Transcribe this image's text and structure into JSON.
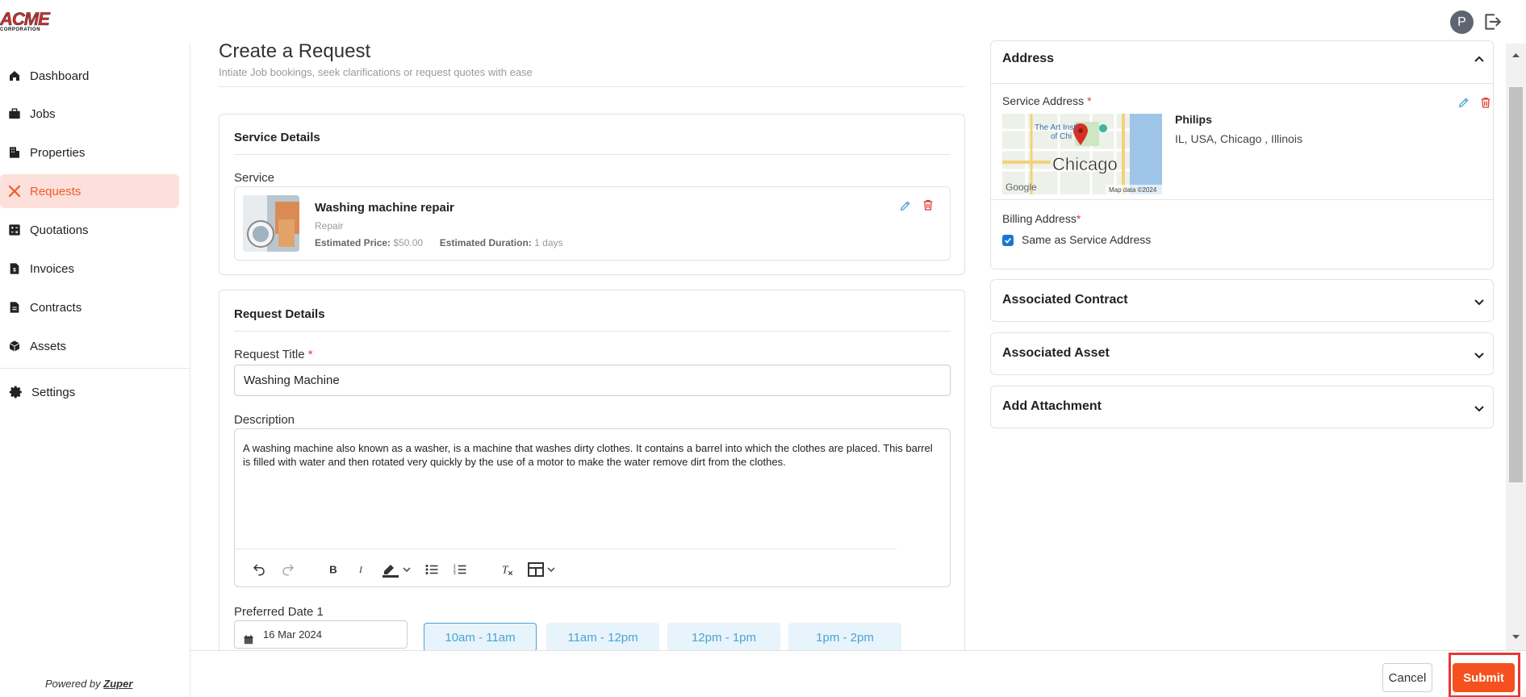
{
  "brand": {
    "logo_text": "ACME",
    "logo_sub": "CORPORATION"
  },
  "header": {
    "avatar_initial": "P"
  },
  "sidebar": {
    "items": [
      {
        "label": "Dashboard",
        "icon": "home-icon",
        "active": false
      },
      {
        "label": "Jobs",
        "icon": "briefcase-icon",
        "active": false
      },
      {
        "label": "Properties",
        "icon": "building-icon",
        "active": false
      },
      {
        "label": "Requests",
        "icon": "tools-icon",
        "active": true
      },
      {
        "label": "Quotations",
        "icon": "calculator-icon",
        "active": false
      },
      {
        "label": "Invoices",
        "icon": "invoice-icon",
        "active": false
      },
      {
        "label": "Contracts",
        "icon": "document-icon",
        "active": false
      },
      {
        "label": "Assets",
        "icon": "box-icon",
        "active": false
      },
      {
        "label": "Settings",
        "icon": "gear-icon",
        "active": false
      }
    ],
    "powered_by": "Powered by",
    "powered_brand": "Zuper"
  },
  "page": {
    "title": "Create a Request",
    "subtitle": "Intiate Job bookings, seek clarifications or request quotes with ease"
  },
  "service_details": {
    "heading": "Service Details",
    "service_label": "Service",
    "service": {
      "name": "Washing machine repair",
      "category": "Repair",
      "price_label": "Estimated Price:",
      "price": "$50.00",
      "duration_label": "Estimated Duration:",
      "duration": "1 days"
    }
  },
  "request_details": {
    "heading": "Request Details",
    "title_label": "Request Title",
    "title_value": "Washing Machine",
    "description_label": "Description",
    "description_value": "A washing machine also known as a washer, is a machine that washes dirty clothes. It contains a barrel into which the clothes are placed. This barrel is filled with water and then rotated very quickly by the use of a motor to make the water remove dirt from the clothes.",
    "preferred_date_label": "Preferred Date 1",
    "preferred_date_value": "16 Mar 2024",
    "time_slots": [
      "10am - 11am",
      "11am - 12pm",
      "12pm - 1pm",
      "1pm - 2pm"
    ],
    "selected_slot": 0
  },
  "address": {
    "heading": "Address",
    "service_address_label": "Service Address",
    "name": "Philips",
    "line": "IL, USA, Chicago , Illinois",
    "map_city": "Chicago",
    "map_poi": "The Art Institute of Chicago",
    "map_brand": "Google",
    "map_credit": "Map data ©2024",
    "billing_label": "Billing Address",
    "same_as_label": "Same as Service Address",
    "same_as_checked": true
  },
  "accordions": [
    {
      "title": "Associated Contract"
    },
    {
      "title": "Associated Asset"
    },
    {
      "title": "Add Attachment"
    }
  ],
  "footer": {
    "cancel": "Cancel",
    "submit": "Submit"
  },
  "colors": {
    "accent": "#f4511e",
    "active_bg": "#fde0db",
    "link_blue": "#4aa3d4",
    "danger": "#e53935"
  }
}
